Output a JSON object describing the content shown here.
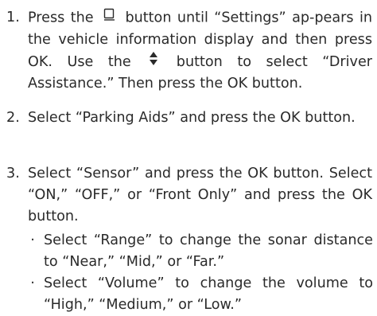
{
  "steps": [
    {
      "number": "1.",
      "part1": "Press the",
      "icon1": "display-toggle-icon",
      "part2": "button until “Settings” ap-pears in the vehicle information display and then press OK. Use the",
      "icon2": "up-down-arrows-icon",
      "part3": "button to select “Driver Assistance.” Then press the OK button."
    },
    {
      "number": "2.",
      "text": "Select “Parking Aids” and press the OK button."
    },
    {
      "number": "3.",
      "text": "Select “Sensor” and press the OK button. Select “ON,” “OFF,” or “Front Only” and press the OK button.",
      "bullets": [
        "Select “Range” to change the sonar distance to “Near,” “Mid,” or “Far.”",
        "Select “Volume” to change the volume to “High,” “Medium,” or “Low.”"
      ]
    }
  ]
}
